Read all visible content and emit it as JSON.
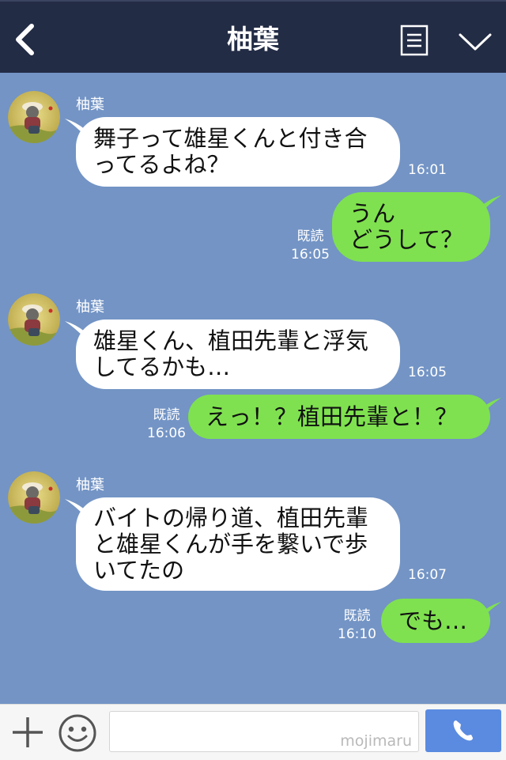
{
  "header": {
    "title": "柚葉"
  },
  "messages": [
    {
      "side": "in",
      "sender": "柚葉",
      "lines": [
        "舞子って雄星くんと付き合",
        "ってるよね？"
      ],
      "time": "16:01"
    },
    {
      "side": "out",
      "lines": [
        "うん",
        "どうして？"
      ],
      "read": "既読",
      "time": "16:05"
    },
    {
      "side": "in",
      "sender": "柚葉",
      "lines": [
        "雄星くん、植田先輩と浮気",
        "してるかも…"
      ],
      "time": "16:05"
    },
    {
      "side": "out",
      "lines": [
        "えっ！？植田先輩と！？"
      ],
      "read": "既読",
      "time": "16:06"
    },
    {
      "side": "in",
      "sender": "柚葉",
      "lines": [
        "バイトの帰り道、植田先輩",
        "と雄星くんが手を繋いで歩",
        "いてたの"
      ],
      "time": "16:07"
    },
    {
      "side": "out",
      "lines": [
        "でも…"
      ],
      "read": "既読",
      "time": "16:10"
    }
  ],
  "input": {
    "placeholder": "",
    "watermark": "mojimaru"
  },
  "colors": {
    "header": "#232c45",
    "chat_bg": "#7394c5",
    "incoming": "#ffffff",
    "outgoing": "#7fe14f",
    "send_button": "#5a8be0"
  },
  "icons": {
    "back": "chevron-left-icon",
    "menu": "list-icon",
    "collapse": "chevron-down-icon",
    "add": "plus-icon",
    "sticker": "smiley-icon",
    "call": "phone-icon"
  }
}
